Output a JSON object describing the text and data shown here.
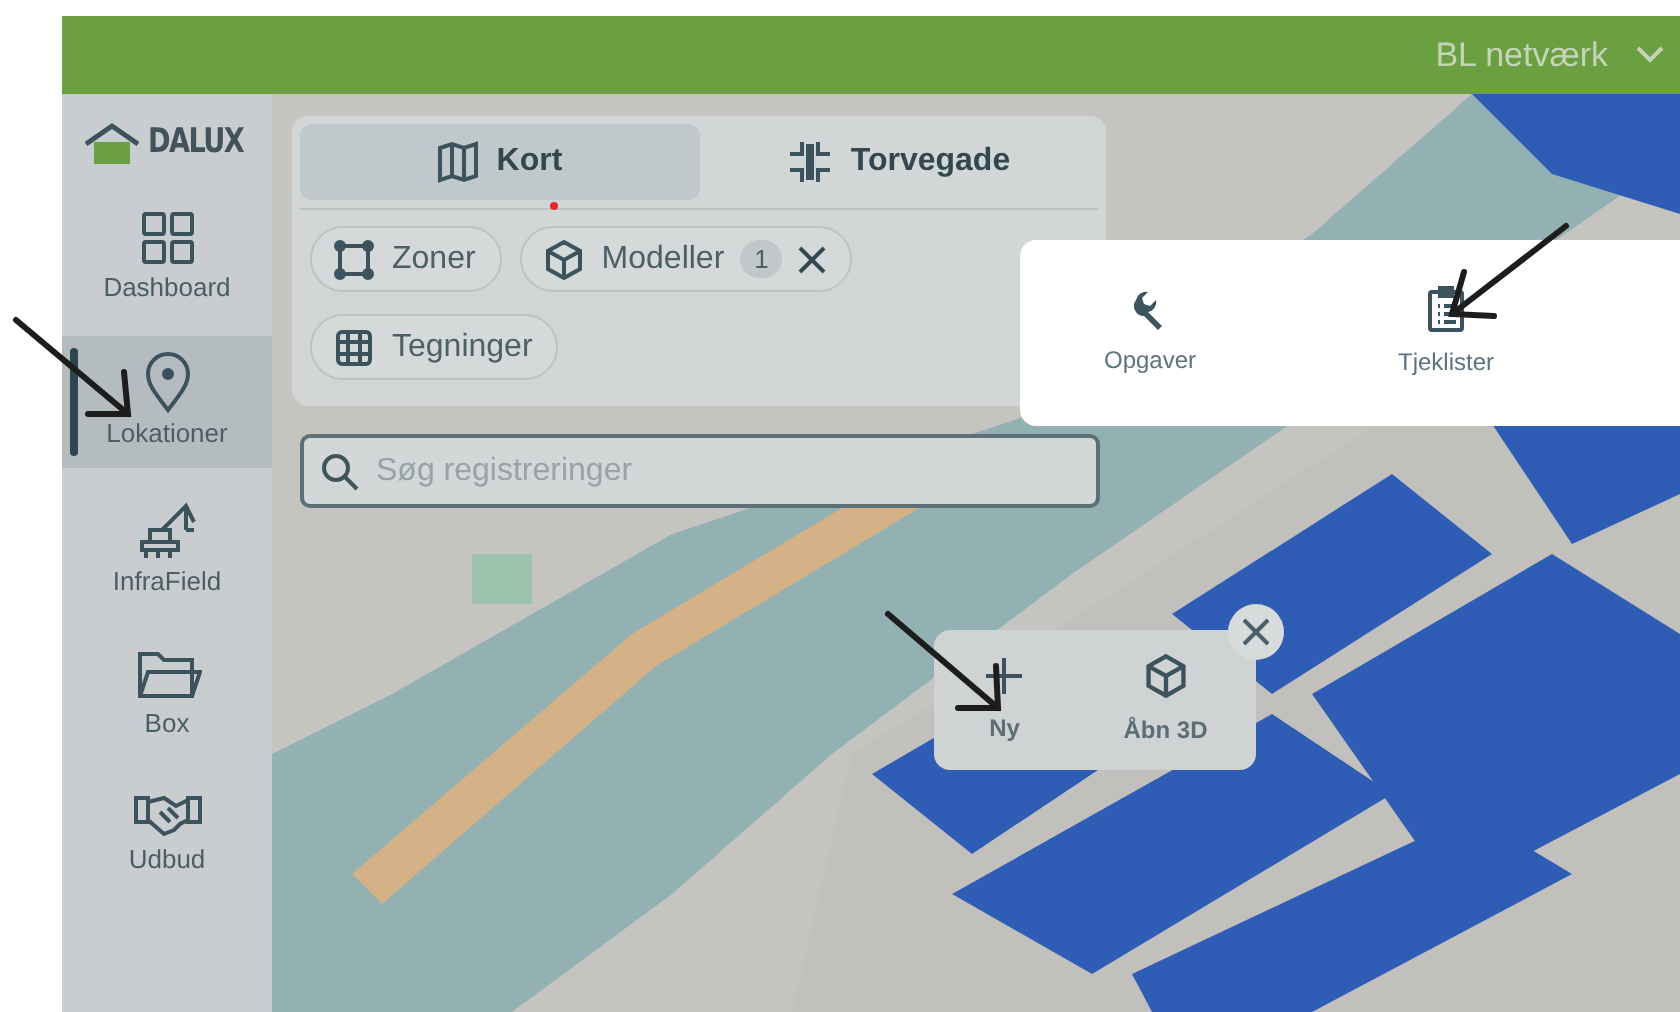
{
  "top_bar": {
    "project": "BL netværk"
  },
  "logo": {
    "text": "DALUX"
  },
  "sidebar": {
    "items": [
      {
        "label": "Dashboard",
        "selected": false
      },
      {
        "label": "Lokationer",
        "selected": true
      },
      {
        "label": "InfraField",
        "selected": false
      },
      {
        "label": "Box",
        "selected": false
      },
      {
        "label": "Udbud",
        "selected": false
      }
    ]
  },
  "map_panel": {
    "tabs": [
      {
        "label": "Kort",
        "selected": true
      },
      {
        "label": "Torvegade",
        "selected": false
      }
    ],
    "filters": [
      {
        "label": "Zoner",
        "alert": false
      },
      {
        "label": "Modeller",
        "count": "1",
        "alert": true
      },
      {
        "label": "Tegninger",
        "alert": false
      }
    ]
  },
  "search": {
    "placeholder": "Søg registreringer"
  },
  "create_menu": {
    "items": [
      {
        "label": "Opgaver"
      },
      {
        "label": "Tjeklister"
      }
    ]
  },
  "map_actions": {
    "items": [
      {
        "label": "Ny"
      },
      {
        "label": "Åbn 3D"
      }
    ]
  }
}
